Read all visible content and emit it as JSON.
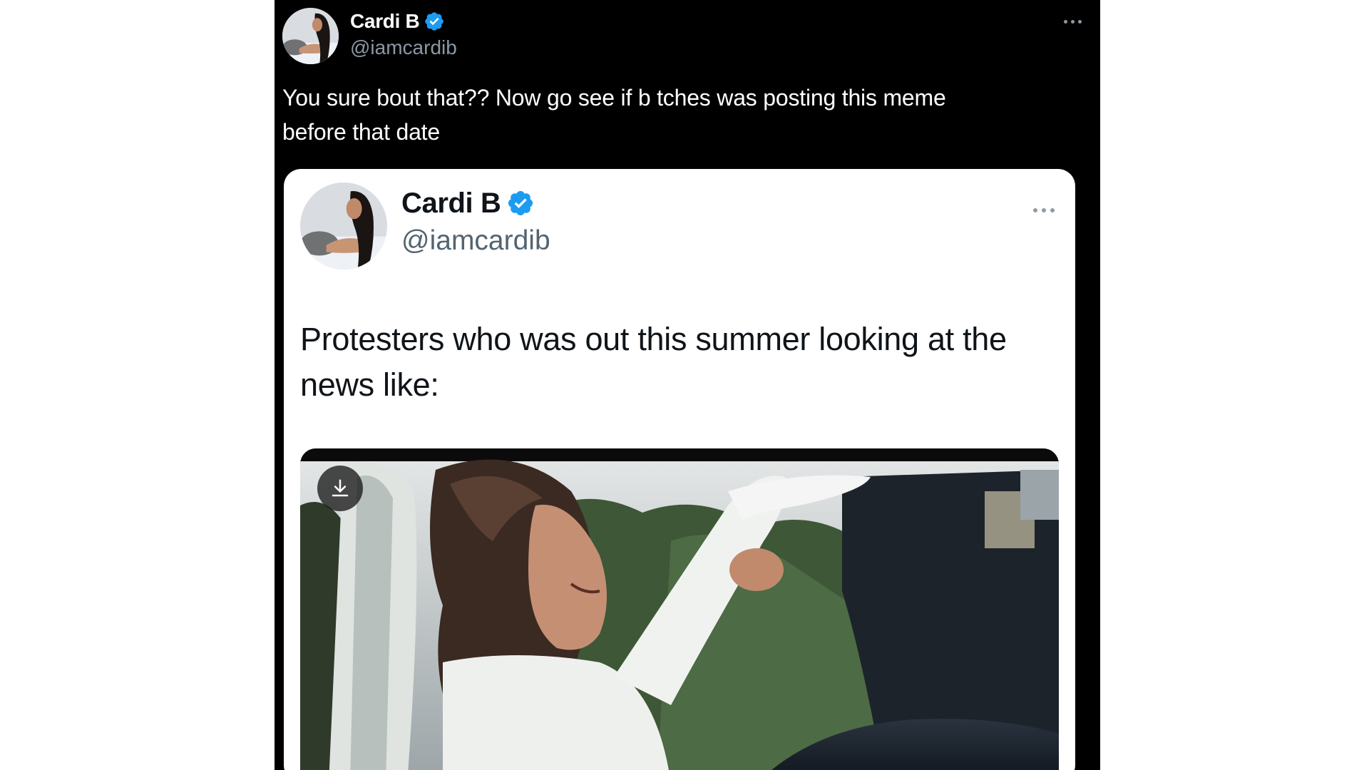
{
  "outer_tweet": {
    "display_name": "Cardi B",
    "handle": "@iamcardib",
    "text_lines": [
      "You sure bout that?? Now go see if b tches was posting this meme",
      "before that date"
    ],
    "avatar_icon": "profile-photo",
    "verified_icon": "verified-badge-icon",
    "more_icon": "more-options-icon"
  },
  "quoted_tweet": {
    "display_name": "Cardi B",
    "handle": "@iamcardib",
    "text_lines": [
      "Protesters who was out this summer looking at the",
      "news like:"
    ],
    "avatar_icon": "profile-photo",
    "verified_icon": "verified-badge-icon",
    "more_icon": "more-options-icon",
    "media": {
      "type": "gif",
      "download_icon": "download-icon"
    }
  },
  "colors": {
    "background": "#000000",
    "card_background": "#ffffff",
    "verified_blue": "#1d9bf0",
    "secondary_text_dark": "#8b98a5",
    "secondary_text_light": "#536471"
  }
}
